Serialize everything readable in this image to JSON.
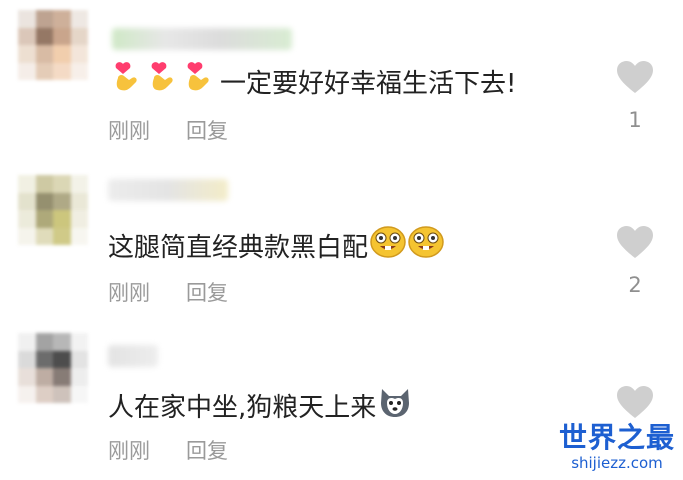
{
  "comments": [
    {
      "text": "一定要好好幸福生活下去!",
      "time": "刚刚",
      "reply_label": "回复",
      "likes": "1",
      "emoji_prefix": [
        "finger-heart-emoji",
        "finger-heart-emoji",
        "finger-heart-emoji"
      ]
    },
    {
      "text": "这腿简直经典款黑白配",
      "time": "刚刚",
      "reply_label": "回复",
      "likes": "2",
      "emoji_suffix": [
        "bucktooth-laugh-emoji",
        "bucktooth-laugh-emoji"
      ]
    },
    {
      "text": "人在家中坐,狗粮天上来",
      "time": "刚刚",
      "reply_label": "回复",
      "likes": "",
      "emoji_suffix": [
        "husky-dog-emoji"
      ]
    }
  ],
  "watermark": {
    "title": "世界之最",
    "url": "shijiezz.com"
  },
  "colors": {
    "like_icon": "#cfcfcf",
    "meta_text": "#9a9a9a",
    "watermark": "#1d5fd1"
  }
}
